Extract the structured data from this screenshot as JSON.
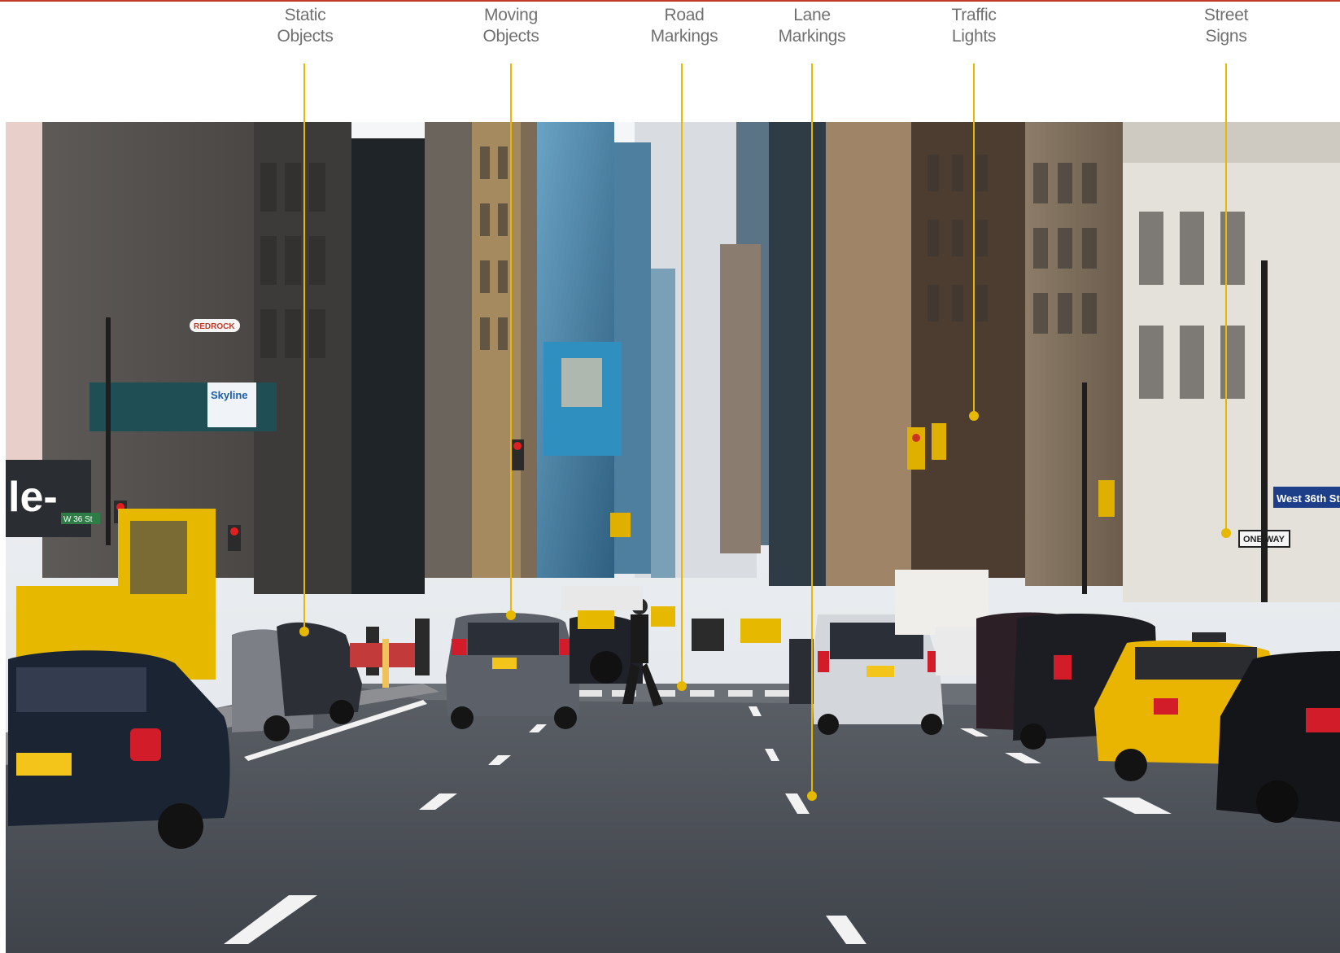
{
  "colors": {
    "accent_line": "#e6b800",
    "top_rule": "#c0392b",
    "label_text": "#707070"
  },
  "callouts": [
    {
      "line1": "Static",
      "line2": "Objects"
    },
    {
      "line1": "Moving",
      "line2": "Objects"
    },
    {
      "line1": "Road",
      "line2": "Markings"
    },
    {
      "line1": "Lane",
      "line2": "Markings"
    },
    {
      "line1": "Traffic",
      "line2": "Lights"
    },
    {
      "line1": "Street",
      "line2": "Signs"
    }
  ],
  "photo": {
    "billboard_text": "le-",
    "skyline_sign": "Skyline",
    "red_sign": "REDROCK",
    "street_sign": "West 36th St",
    "street_sign_small": "W 36 St",
    "one_way_sign": "ONE WAY"
  }
}
